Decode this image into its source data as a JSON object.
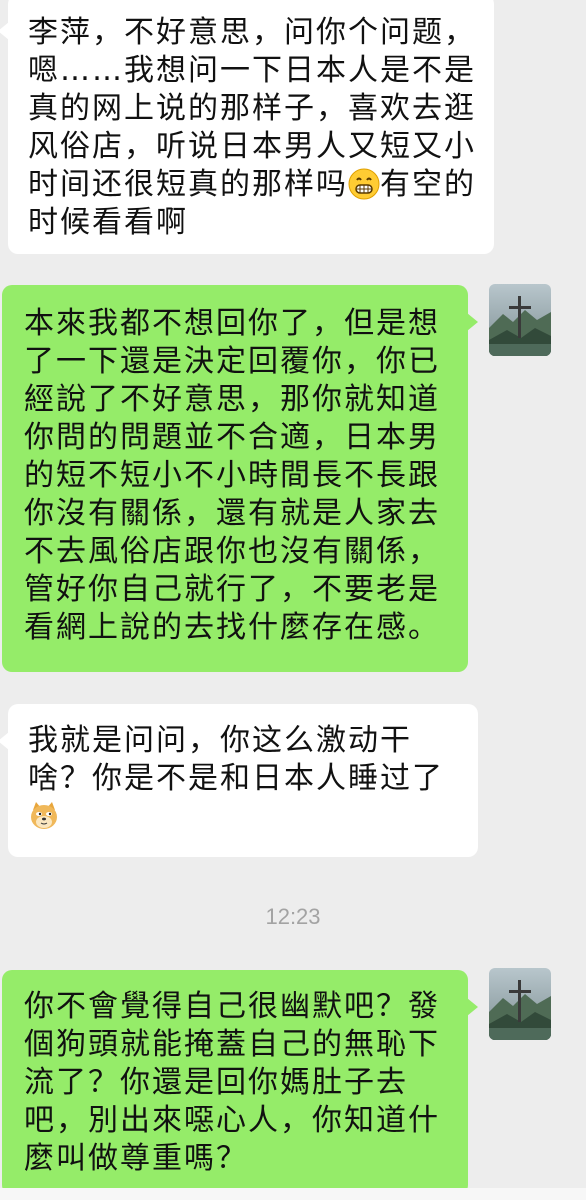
{
  "messages": [
    {
      "side": "received",
      "text": "李萍，不好意思，问你个问题，嗯……我想问一下日本人是不是真的网上说的那样子，喜欢去逛风俗店，听说日本男人又短又小时间还很短真的那样吗",
      "text_after_emoji": "有空的时候看看啊",
      "emoji": "grinning-face-emoji"
    },
    {
      "side": "sent",
      "text": "本來我都不想回你了，但是想了一下還是決定回覆你，你已經說了不好意思，那你就知道你問的問題並不合適，日本男的短不短小不小時間長不長跟你沒有關係，還有就是人家去不去風俗店跟你也沒有關係，管好你自己就行了，不要老是看網上說的去找什麼存在感。"
    },
    {
      "side": "received",
      "text": "我就是问问，你这么激动干啥？你是不是和日本人睡过了",
      "emoji": "doge-emoji"
    },
    {
      "side": "sent",
      "text": "你不會覺得自己很幽默吧？發個狗頭就能掩蓋自己的無恥下流了？你還是回你媽肚子去吧，別出來噁心人，你知道什麼叫做尊重嗎？"
    }
  ],
  "timestamp": "12:23",
  "colors": {
    "background": "#ededed",
    "sent_bubble": "#95ec69",
    "received_bubble": "#ffffff",
    "timestamp_text": "#a3a3a3"
  }
}
